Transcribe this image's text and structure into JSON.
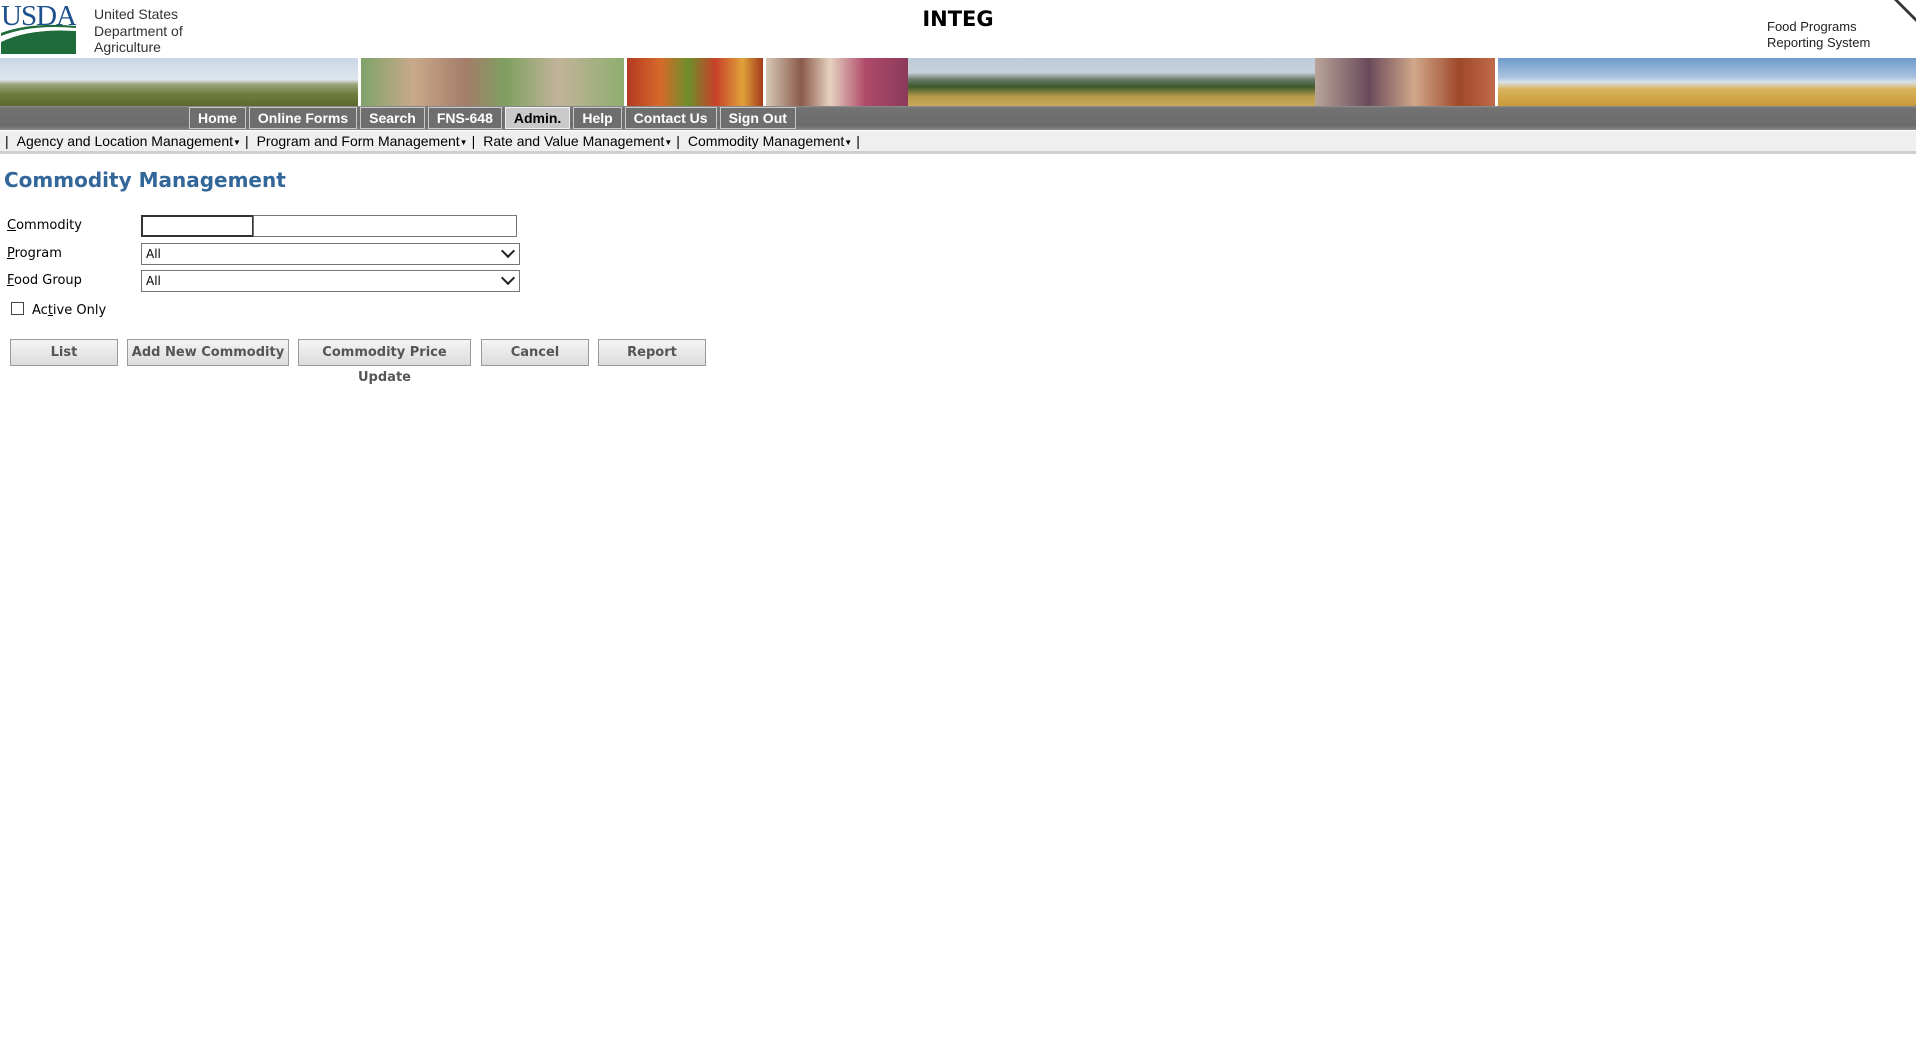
{
  "header": {
    "logo_text": "USDA",
    "agency_line1": "United States",
    "agency_line2": "Department of",
    "agency_line3": "Agriculture",
    "environment": "INTEG",
    "system_line1": "Food Programs",
    "system_line2": "Reporting System"
  },
  "main_nav": [
    {
      "label": "Home"
    },
    {
      "label": "Online Forms"
    },
    {
      "label": "Search"
    },
    {
      "label": "FNS-648"
    },
    {
      "label": "Admin."
    },
    {
      "label": "Help"
    },
    {
      "label": "Contact Us"
    },
    {
      "label": "Sign Out"
    }
  ],
  "main_nav_active": "Admin.",
  "sub_nav": [
    {
      "label": "Agency and Location Management"
    },
    {
      "label": "Program and Form Management"
    },
    {
      "label": "Rate and Value Management"
    },
    {
      "label": "Commodity Management"
    }
  ],
  "page": {
    "title": "Commodity Management"
  },
  "form": {
    "commodity_label_first": "C",
    "commodity_label_rest": "ommodity",
    "commodity_code_value": "",
    "commodity_name_value": "",
    "program_label_first": "P",
    "program_label_rest": "rogram",
    "program_selected": "All",
    "food_group_label_first": "F",
    "food_group_label_rest": "ood Group",
    "food_group_selected": "All",
    "active_only_label_a": "Ac",
    "active_only_label_u": "t",
    "active_only_label_rest": "ive Only",
    "active_only_checked": false
  },
  "buttons": {
    "list": "List",
    "add_new": "Add New Commodity",
    "price_update": "Commodity Price Update",
    "cancel": "Cancel",
    "report": "Report"
  },
  "colors": {
    "title": "#336699",
    "usda_green": "#1f6b3a",
    "usda_blue": "#1c4f8c",
    "nav_bg": "#6e6e6e"
  }
}
